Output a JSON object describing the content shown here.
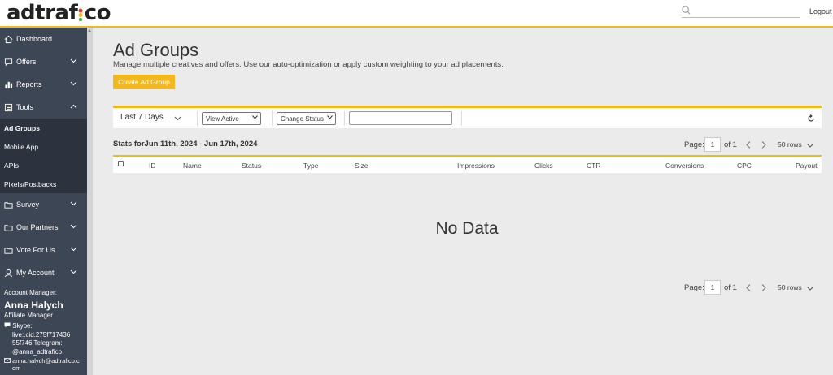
{
  "header": {
    "logo_prefix": "adtraf",
    "logo_i": "i",
    "logo_suffix": "co",
    "search_placeholder": "",
    "logout_label": "Logout"
  },
  "sidebar": {
    "items": [
      {
        "label": "Dashboard",
        "icon": "home-icon"
      },
      {
        "label": "Offers",
        "icon": "chat-icon"
      },
      {
        "label": "Reports",
        "icon": "bar-chart-icon"
      },
      {
        "label": "Tools",
        "icon": "tools-icon"
      }
    ],
    "tools_sub": [
      "Ad Groups",
      "Mobile App",
      "APIs",
      "Pixels/Postbacks"
    ],
    "items2": [
      {
        "label": "Survey",
        "icon": "folder-icon"
      },
      {
        "label": "Our Partners",
        "icon": "folder-icon"
      },
      {
        "label": "Vote For Us",
        "icon": "folder-icon"
      },
      {
        "label": "My Account",
        "icon": "user-icon"
      }
    ],
    "account": {
      "heading": "Account Manager:",
      "name": "Anna Halych",
      "role": "Affiliate Manager",
      "skype_label": "Skype:",
      "skype_line1": "live:.cid.275f717436",
      "skype_line2": "55f746 Telegram:",
      "telegram": "@anna_adtrafico",
      "email_line1": "anna.halych@adtrafico.c",
      "email_line2": "om"
    }
  },
  "main": {
    "title": "Ad Groups",
    "subtitle": "Manage multiple creatives and offers. Use our auto-optimization or apply custom weighting to your ad placements.",
    "create_button": "Create Ad Group",
    "filters": {
      "period": "Last 7 Days",
      "view": "View Active",
      "status": "Change Status",
      "text_value": ""
    },
    "stats_label": "Stats forJun 11th, 2024 - Jun 17th, 2024",
    "pager": {
      "page_label": "Page:",
      "page_value": "1",
      "of_label": "of 1",
      "rows_label": "50 rows"
    },
    "columns": [
      "ID",
      "Name",
      "Status",
      "Type",
      "Size",
      "Impressions",
      "Clicks",
      "CTR",
      "Conversions",
      "CPC",
      "Payout"
    ],
    "empty_message": "No Data"
  },
  "colors": {
    "accent": "#f2b81e",
    "sidebar_bg": "#3d4654",
    "sidebar_sub_bg": "#2c333e",
    "page_bg": "#ebebeb"
  }
}
